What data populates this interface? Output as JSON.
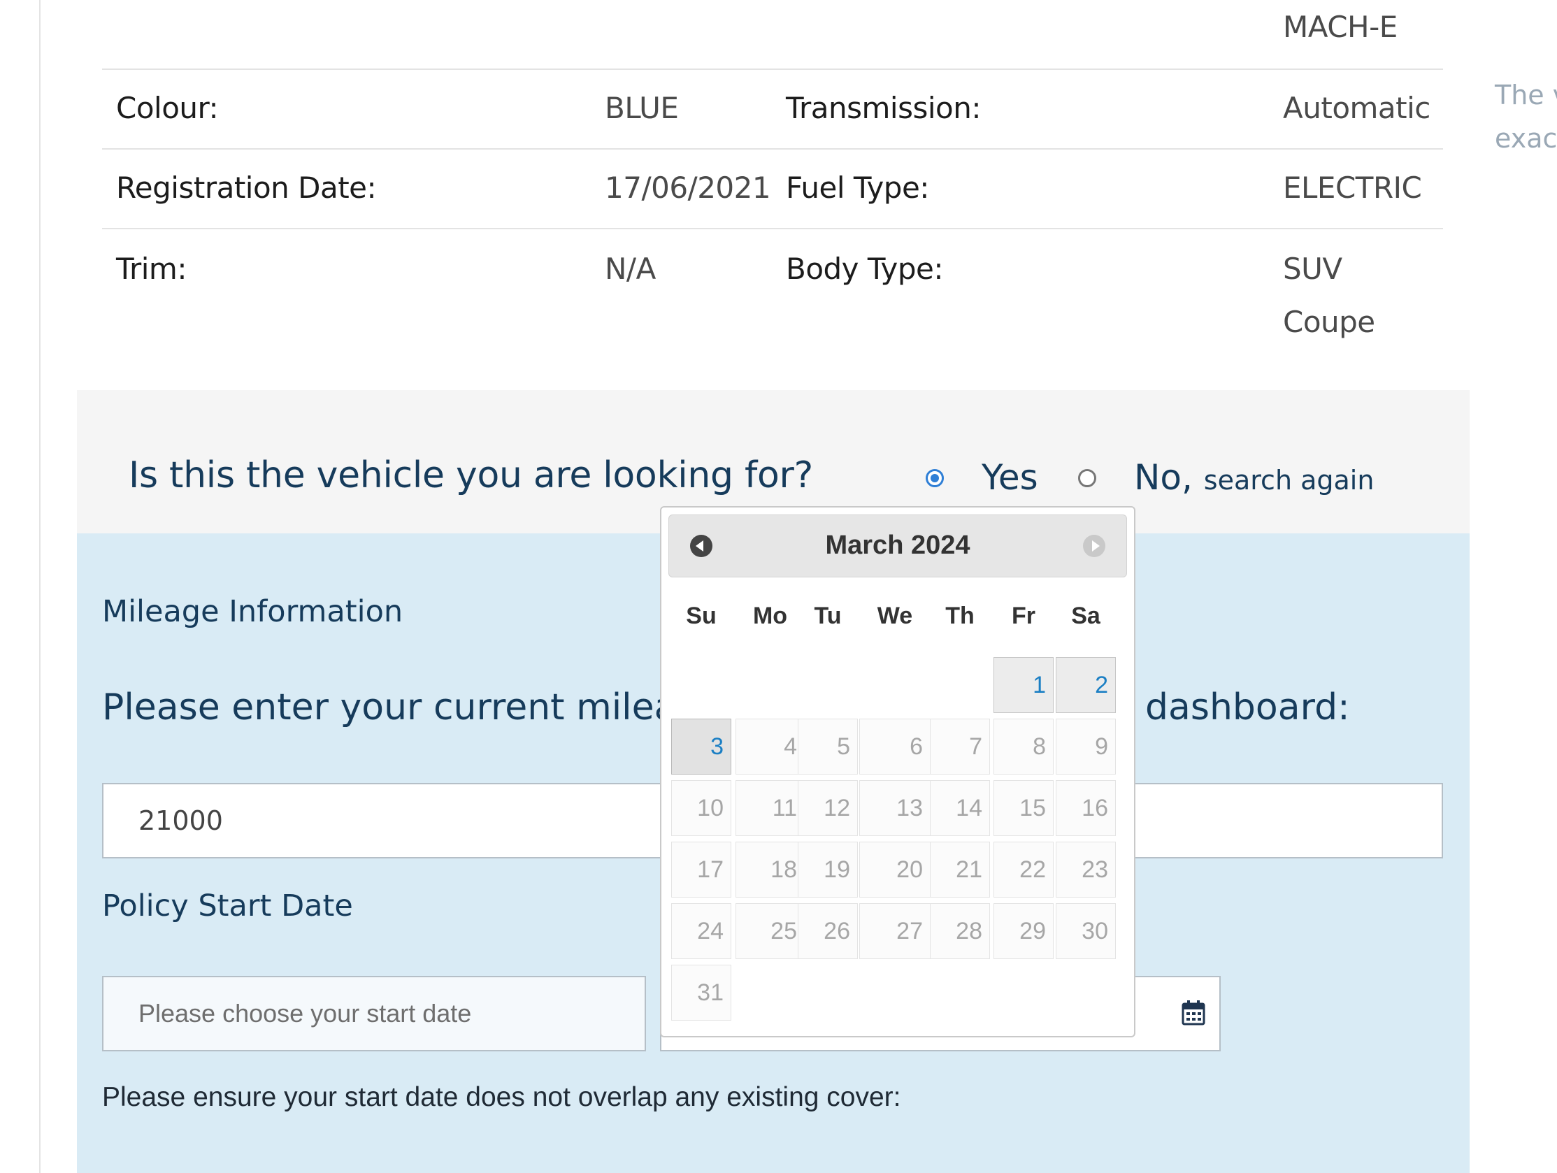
{
  "vehicle": {
    "model_continuation": "MACH-E",
    "rows": [
      {
        "label1": "Colour:",
        "value1": "BLUE",
        "label2": "Transmission:",
        "value2": "Automatic"
      },
      {
        "label1": "Registration Date:",
        "value1": "17/06/2021",
        "label2": "Fuel Type:",
        "value2": "ELECTRIC"
      },
      {
        "label1": "Trim:",
        "value1": "N/A",
        "label2": "Body Type:",
        "value2": "SUV",
        "value2b": "Coupe"
      }
    ],
    "side_note": [
      "The v",
      "exact"
    ]
  },
  "question": {
    "text": "Is this the vehicle you are looking for?",
    "yes_label": "Yes",
    "no_label": "No,",
    "no_sublabel": "search again",
    "selected": "yes"
  },
  "mileage": {
    "heading": "Mileage Information",
    "prompt_left": "Please enter your current mileage",
    "prompt_right": "dashboard:",
    "value": "21000"
  },
  "policy": {
    "heading": "Policy Start Date",
    "placeholder": "Please choose your start date",
    "note": "Please ensure your start date does not overlap any existing cover:",
    "icon": "calendar-icon"
  },
  "datepicker": {
    "title": "March 2024",
    "prev_icon": "prev-month-icon",
    "next_icon": "next-month-icon",
    "weekdays": [
      "Su",
      "Mo",
      "Tu",
      "We",
      "Th",
      "Fr",
      "Sa"
    ],
    "first_weekday_index": 5,
    "days_in_month": 31,
    "enabled_days": [
      1,
      2,
      3
    ],
    "today": 3
  },
  "colors": {
    "navy_text": "#163b5b",
    "panel_blue": "#d9ebf5",
    "link_blue": "#1b7fc4",
    "radio_blue": "#2f7fd6"
  }
}
